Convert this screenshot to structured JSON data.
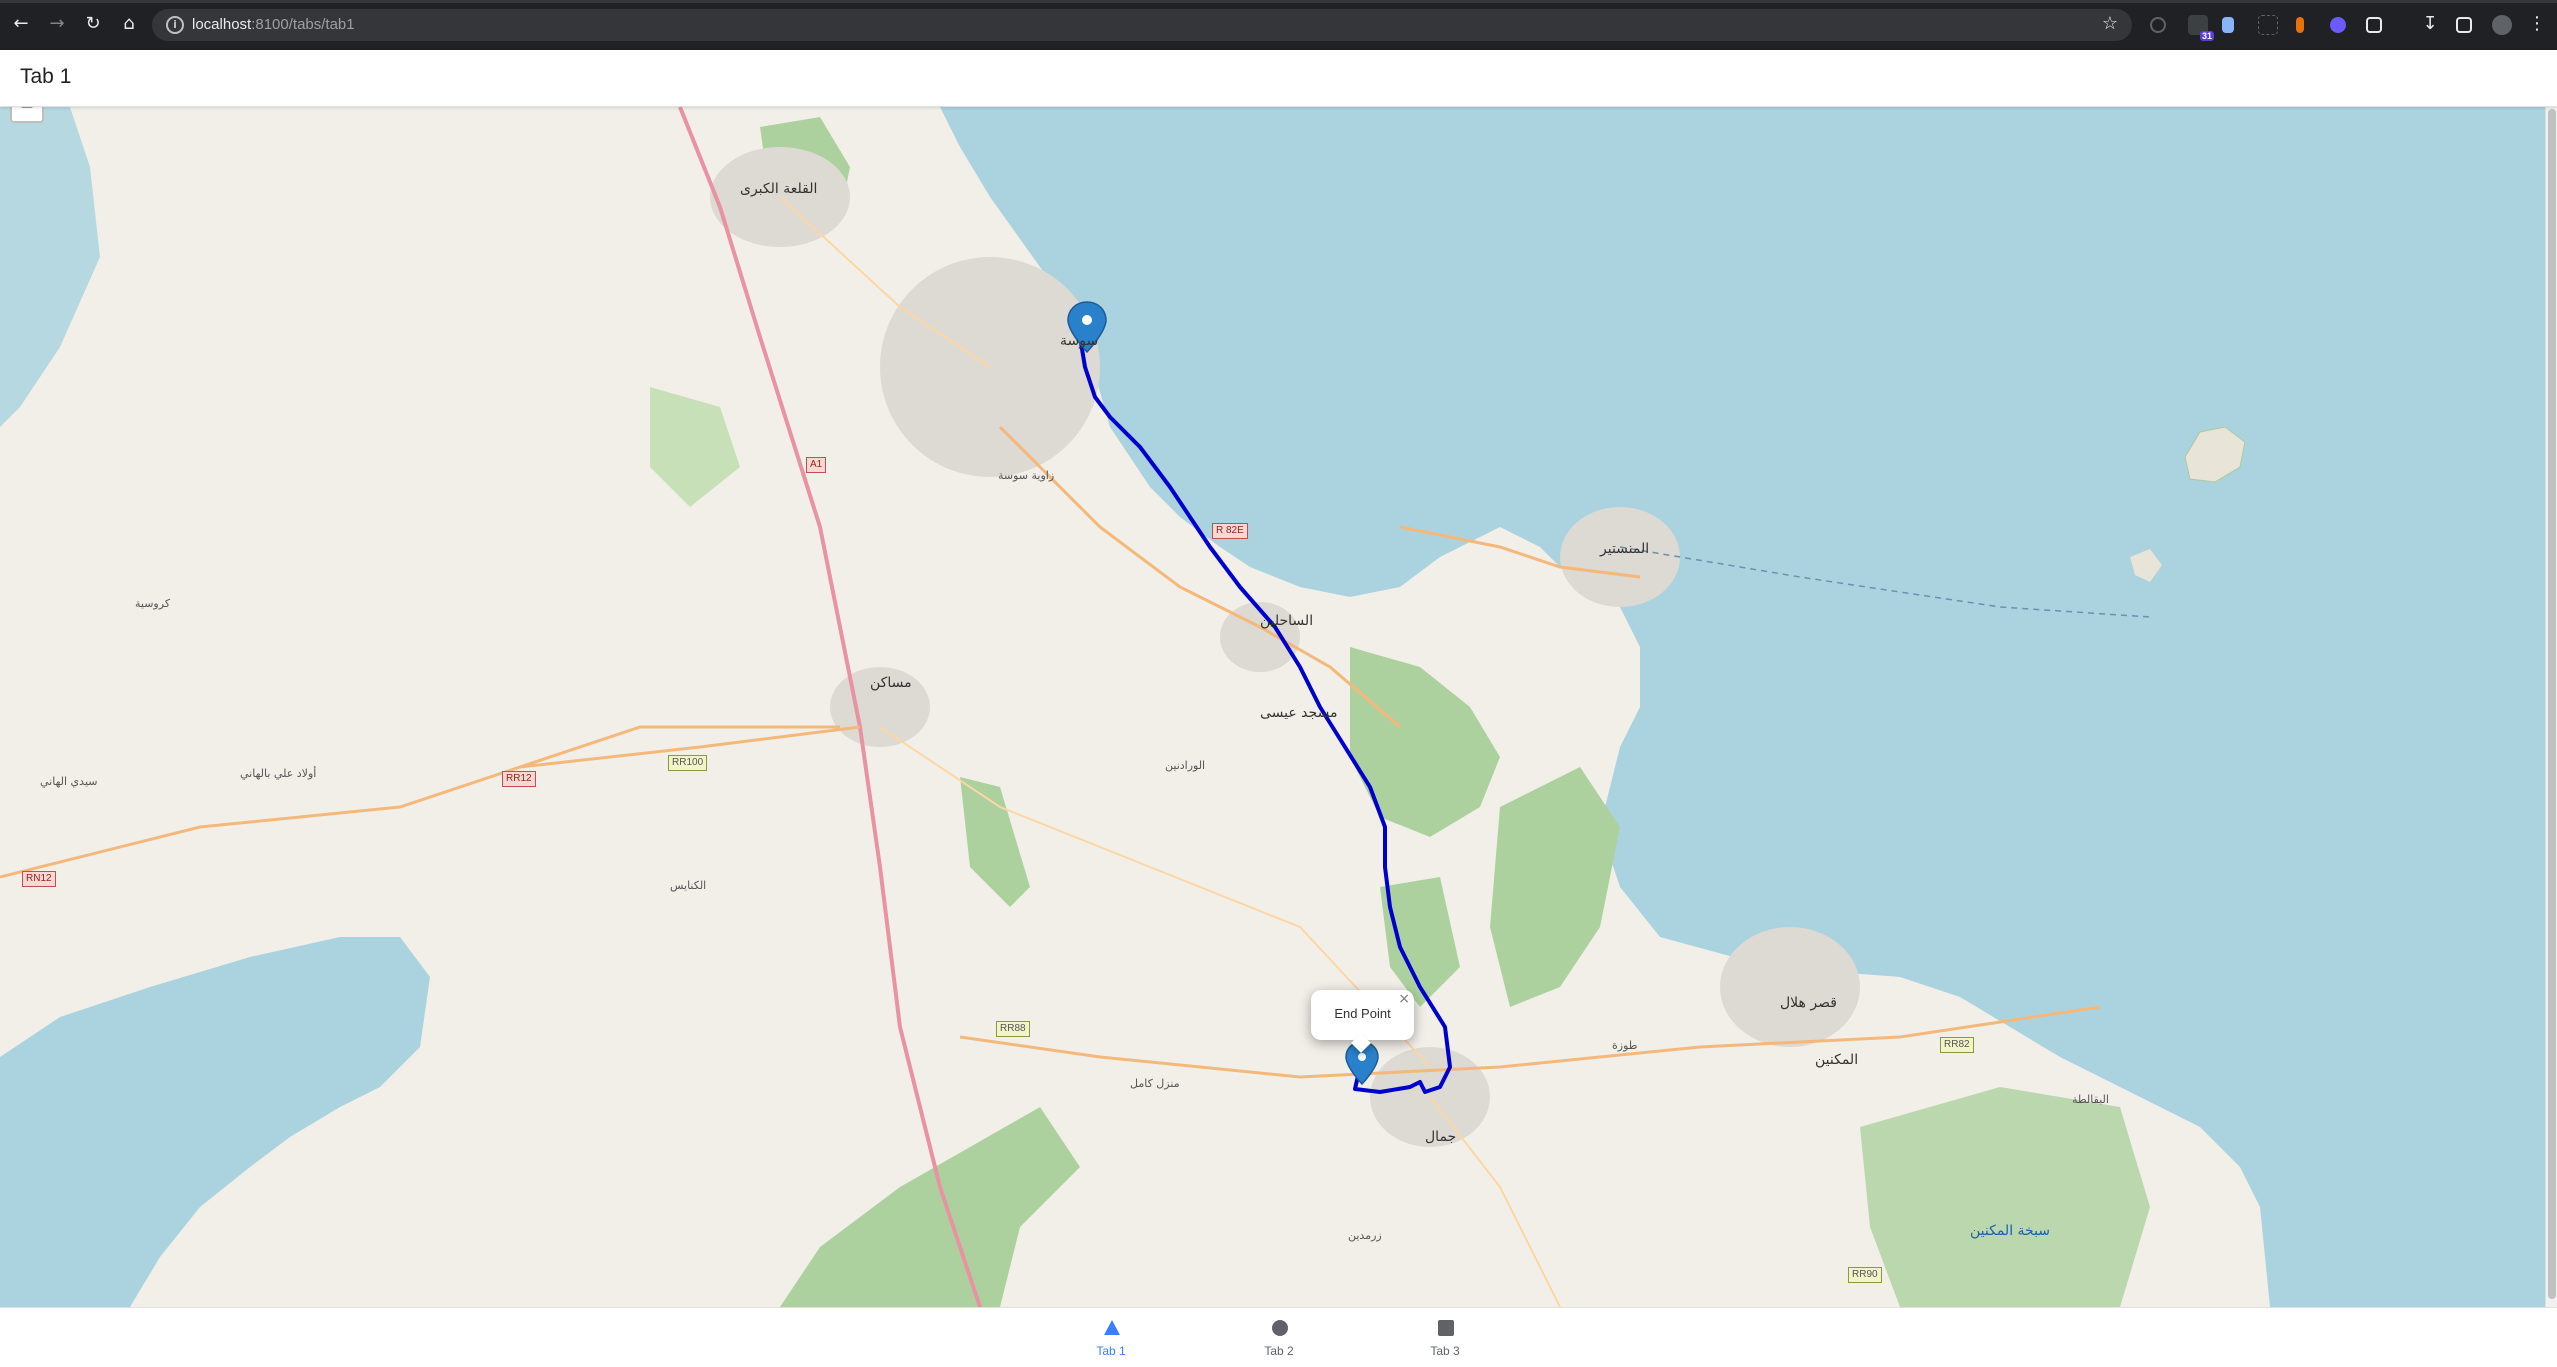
{
  "browser": {
    "url_host": "localhost",
    "url_path": ":8100/tabs/tab1",
    "calendar_badge": "31"
  },
  "header": {
    "title": "Tab 1"
  },
  "map": {
    "zoom_out_label": "−",
    "popup": {
      "text": "End Point",
      "close": "×"
    },
    "place_labels": [
      "القلعة الكبرى",
      "المنستير",
      "الساحلين",
      "مسجد عيسى",
      "مساكن",
      "قصر هلال",
      "المكنين",
      "جمال",
      "سيدي الهاني",
      "أولاد علي بالهاني",
      "كروسية",
      "الكنايس",
      "منزل كامل",
      "الورادنين",
      "زاوية سوسة",
      "سوسة",
      "سبخة المكنين",
      "طوزة",
      "زرمدين",
      "البقالطة"
    ],
    "road_labels": [
      "RR100",
      "RR12",
      "RN12",
      "RR88",
      "RR82",
      "RR90",
      "A1",
      "R 82E"
    ],
    "route_color": "#0000cc",
    "sea_color": "#aad3df"
  },
  "tabs": [
    {
      "label": "Tab 1",
      "icon": "triangle-icon",
      "active": true
    },
    {
      "label": "Tab 2",
      "icon": "ellipse-icon",
      "active": false
    },
    {
      "label": "Tab 3",
      "icon": "square-icon",
      "active": false
    }
  ]
}
